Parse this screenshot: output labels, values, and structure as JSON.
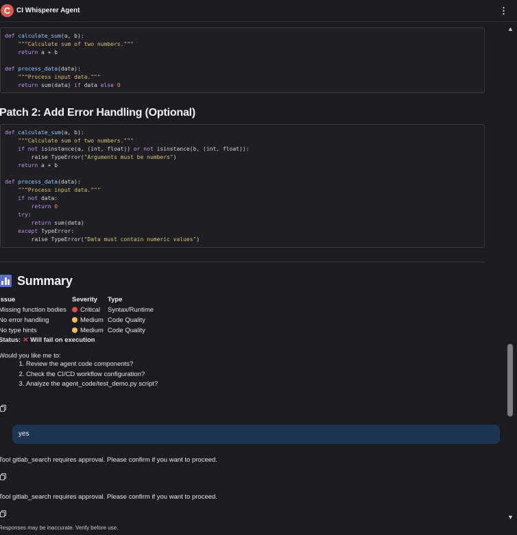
{
  "header": {
    "logo_letter": "C",
    "title": "CI Whisperer Agent",
    "menu_glyph": "⋮"
  },
  "code_block_1": [
    [
      [
        "def ",
        "kw"
      ],
      [
        "calculate_sum",
        "fn"
      ],
      [
        "(a, b):",
        ""
      ]
    ],
    [
      [
        "    \"\"\"Calculate sum of two numbers.\"\"\"",
        "str"
      ]
    ],
    [
      [
        "    ",
        ""
      ],
      [
        "return",
        "kw"
      ],
      [
        " a + b",
        ""
      ]
    ],
    [
      [
        "",
        ""
      ]
    ],
    [
      [
        "def ",
        "kw"
      ],
      [
        "process_data",
        "fn"
      ],
      [
        "(data):",
        ""
      ]
    ],
    [
      [
        "    \"\"\"Process input data.\"\"\"",
        "str"
      ]
    ],
    [
      [
        "    ",
        ""
      ],
      [
        "return",
        "kw"
      ],
      [
        " sum(data) ",
        ""
      ],
      [
        "if",
        "kw"
      ],
      [
        " data ",
        ""
      ],
      [
        "else",
        "kw"
      ],
      [
        " ",
        ""
      ],
      [
        "0",
        "num"
      ]
    ]
  ],
  "patch2_title": "Patch 2: Add Error Handling (Optional)",
  "code_block_2": [
    [
      [
        "def ",
        "kw"
      ],
      [
        "calculate_sum",
        "fn"
      ],
      [
        "(a, b):",
        ""
      ]
    ],
    [
      [
        "    \"\"\"Calculate sum of two numbers.\"\"\"",
        "str"
      ]
    ],
    [
      [
        "    ",
        ""
      ],
      [
        "if not",
        "kw"
      ],
      [
        " isinstance(a, (int, float)) ",
        ""
      ],
      [
        "or not",
        "kw"
      ],
      [
        " isinstance(b, (int, float)):",
        ""
      ]
    ],
    [
      [
        "        raise ",
        ""
      ],
      [
        "TypeError(",
        ""
      ],
      [
        "\"Arguments must be numbers\"",
        "str"
      ],
      [
        ")",
        ""
      ]
    ],
    [
      [
        "    ",
        ""
      ],
      [
        "return",
        "kw"
      ],
      [
        " a + b",
        ""
      ]
    ],
    [
      [
        "",
        ""
      ]
    ],
    [
      [
        "def ",
        "kw"
      ],
      [
        "process_data",
        "fn"
      ],
      [
        "(data):",
        ""
      ]
    ],
    [
      [
        "    \"\"\"Process input data.\"\"\"",
        "str"
      ]
    ],
    [
      [
        "    ",
        ""
      ],
      [
        "if not",
        "kw"
      ],
      [
        " data:",
        ""
      ]
    ],
    [
      [
        "        ",
        ""
      ],
      [
        "return",
        "kw"
      ],
      [
        " ",
        ""
      ],
      [
        "0",
        "num"
      ]
    ],
    [
      [
        "    ",
        ""
      ],
      [
        "try",
        "kw"
      ],
      [
        ":",
        ""
      ]
    ],
    [
      [
        "        ",
        ""
      ],
      [
        "return",
        "kw"
      ],
      [
        " sum(data)",
        ""
      ]
    ],
    [
      [
        "    ",
        ""
      ],
      [
        "except",
        "kw"
      ],
      [
        " TypeError:",
        ""
      ]
    ],
    [
      [
        "        raise ",
        ""
      ],
      [
        "TypeError(",
        ""
      ],
      [
        "\"Data must contain numeric values\"",
        "str"
      ],
      [
        ")",
        ""
      ]
    ]
  ],
  "summary": {
    "title": "Summary",
    "columns": [
      "Issue",
      "Severity",
      "Type"
    ],
    "rows": [
      {
        "issue": "Missing function bodies",
        "severity": "Critical",
        "severity_color": "#e5484d",
        "type": "Syntax/Runtime"
      },
      {
        "issue": "No error handling",
        "severity": "Medium",
        "severity_color": "#f2c14e",
        "type": "Code Quality"
      },
      {
        "issue": "No type hints",
        "severity": "Medium",
        "severity_color": "#f2c14e",
        "type": "Code Quality"
      }
    ],
    "status_label": "Status:",
    "status_value": "Will fail on execution"
  },
  "followup": {
    "intro": "Would you like me to:",
    "steps": [
      "Review the agent code components?",
      "Check the CI/CD workflow configuration?",
      "Analyze the agent_code/test_demo.py script?"
    ]
  },
  "user_message": "yes",
  "tool_messages": [
    "Tool gitlab_search requires approval. Please confirm if you want to proceed.",
    "Tool gitlab_search requires approval. Please confirm if you want to proceed."
  ],
  "footer_note": "Responses may be inaccurate. Verify before use.",
  "colors": {
    "background": "#1c1b21",
    "user_bubble": "#1e3453",
    "critical": "#e5484d",
    "medium": "#f2c14e"
  }
}
